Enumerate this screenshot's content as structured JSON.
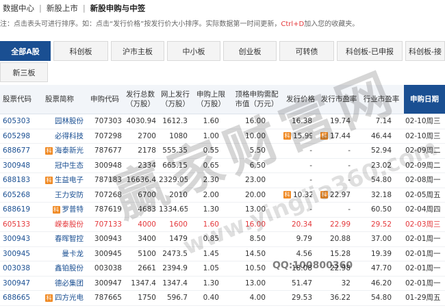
{
  "breadcrumb": [
    "数据中心",
    "新股上市",
    "新股申购与中签"
  ],
  "note": {
    "text": "注：点击表头可进行排序。如：点击“发行价格”按发行价大小排序。实际数据第一时间更新，",
    "highlight": "Ctrl+D",
    "tail": "加入您的收藏夹。"
  },
  "tabs": [
    "全部A股",
    "科创板",
    "沪市主板",
    "中小板",
    "创业板",
    "可转债",
    "科创板-已申报",
    "科创板-接",
    "新三板"
  ],
  "columns": [
    "股票代码",
    "股票简称",
    "申购代码",
    "发行总数\n（万股）",
    "网上发行\n（万股）",
    "申购上限\n（万股）",
    "顶格申购需配\n市值（万元）",
    "发行价格",
    "发行市盈率",
    "行业市盈率",
    "申购日期"
  ],
  "badge_text": "科",
  "rows": [
    {
      "code": "605303",
      "name": "园林股份",
      "sub": "707303",
      "total": "4030.94",
      "online": "1612.3",
      "limit": "1.60",
      "need": "16.00",
      "price": "16.38",
      "pe": "19.74",
      "ind": "7.14",
      "date": "02-10周三"
    },
    {
      "code": "605298",
      "name": "必得科技",
      "sub": "707298",
      "total": "2700",
      "online": "1080",
      "limit": "1.00",
      "need": "10.00",
      "price": "15.99",
      "pe": "17.44",
      "ind": "46.44",
      "date": "02-10周三",
      "pbadge": true
    },
    {
      "code": "688677",
      "name": "海泰新光",
      "sub": "787677",
      "total": "2178",
      "online": "555.35",
      "limit": "0.55",
      "need": "5.50",
      "price": "-",
      "pe": "-",
      "ind": "52.94",
      "date": "02-09周二",
      "badge": true
    },
    {
      "code": "300948",
      "name": "冠中生态",
      "sub": "300948",
      "total": "2334",
      "online": "665.15",
      "limit": "0.65",
      "need": "6.50",
      "price": "-",
      "pe": "-",
      "ind": "23.02",
      "date": "02-09周二"
    },
    {
      "code": "688183",
      "name": "生益电子",
      "sub": "787183",
      "total": "16636.4",
      "online": "2329.05",
      "limit": "2.30",
      "need": "23.00",
      "price": "-",
      "pe": "-",
      "ind": "54.80",
      "date": "02-08周一",
      "badge": true
    },
    {
      "code": "605268",
      "name": "王力安防",
      "sub": "707268",
      "total": "6700",
      "online": "2010",
      "limit": "2.00",
      "need": "20.00",
      "price": "10.32",
      "pe": "22.97",
      "ind": "32.18",
      "date": "02-05周五",
      "pbadge": true
    },
    {
      "code": "688619",
      "name": "罗普特",
      "sub": "787619",
      "total": "4683",
      "online": "1334.65",
      "limit": "1.30",
      "need": "13.00",
      "price": "-",
      "pe": "-",
      "ind": "60.50",
      "date": "02-04周四",
      "badge": true
    },
    {
      "code": "605133",
      "name": "嵘泰股份",
      "sub": "707133",
      "total": "4000",
      "online": "1600",
      "limit": "1.60",
      "need": "16.00",
      "price": "20.34",
      "pe": "22.99",
      "ind": "29.52",
      "date": "02-03周三",
      "hi": true
    },
    {
      "code": "300943",
      "name": "春晖智控",
      "sub": "300943",
      "total": "3400",
      "online": "1479",
      "limit": "0.85",
      "need": "8.50",
      "price": "9.79",
      "pe": "20.88",
      "ind": "37.00",
      "date": "02-01周一"
    },
    {
      "code": "300945",
      "name": "曼卡龙",
      "sub": "300945",
      "total": "5100",
      "online": "2473.5",
      "limit": "1.45",
      "need": "14.50",
      "price": "4.56",
      "pe": "15.28",
      "ind": "19.39",
      "date": "02-01周一"
    },
    {
      "code": "003038",
      "name": "鑫铂股份",
      "sub": "003038",
      "total": "2661",
      "online": "2394.9",
      "limit": "1.05",
      "need": "10.50",
      "price": "18.08",
      "pe": "22.98",
      "ind": "47.70",
      "date": "02-01周一"
    },
    {
      "code": "300947",
      "name": "德必集团",
      "sub": "300947",
      "total": "1347.4",
      "online": "1347.4",
      "limit": "1.30",
      "need": "13.00",
      "price": "51.47",
      "pe": "32",
      "ind": "46.20",
      "date": "02-01周一"
    },
    {
      "code": "688665",
      "name": "四方光电",
      "sub": "787665",
      "total": "1750",
      "online": "596.7",
      "limit": "0.40",
      "need": "4.00",
      "price": "29.53",
      "pe": "36.22",
      "ind": "54.80",
      "date": "01-29周五",
      "badge": true
    }
  ],
  "watermark": {
    "main": "赢家财富网",
    "url": "www.yingjia360.com",
    "qq": "QQ:100800360"
  },
  "colors": {
    "primary": "#1a4f92",
    "red": "#e4393c",
    "badge": "#f08a24"
  }
}
